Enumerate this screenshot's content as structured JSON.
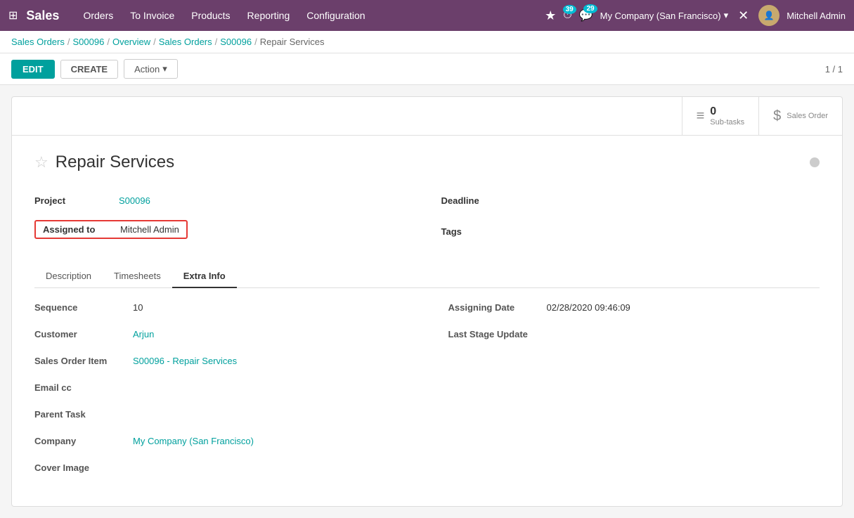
{
  "topnav": {
    "app_title": "Sales",
    "nav_items": [
      "Orders",
      "To Invoice",
      "Products",
      "Reporting",
      "Configuration"
    ],
    "badge_clock": "39",
    "badge_chat": "29",
    "company": "My Company (San Francisco)",
    "user_name": "Mitchell Admin"
  },
  "breadcrumb": {
    "items": [
      "Sales Orders",
      "S00096",
      "Overview",
      "Sales Orders",
      "S00096"
    ],
    "current": "Repair Services"
  },
  "toolbar": {
    "edit_label": "EDIT",
    "create_label": "CREATE",
    "action_label": "Action",
    "record_nav": "1 / 1"
  },
  "smart_buttons": [
    {
      "icon": "≡",
      "count": "0",
      "label": "Sub-tasks"
    },
    {
      "icon": "$",
      "count": "",
      "label": "Sales Order"
    }
  ],
  "form": {
    "title": "Repair Services",
    "project_label": "Project",
    "project_value": "S00096",
    "assigned_to_label": "Assigned to",
    "assigned_to_value": "Mitchell Admin",
    "deadline_label": "Deadline",
    "deadline_value": "",
    "tags_label": "Tags",
    "tags_value": ""
  },
  "tabs": [
    {
      "label": "Description"
    },
    {
      "label": "Timesheets"
    },
    {
      "label": "Extra Info",
      "active": true
    }
  ],
  "extra_info": {
    "left_fields": [
      {
        "label": "Sequence",
        "value": "10",
        "type": "plain"
      },
      {
        "label": "Customer",
        "value": "Arjun",
        "type": "link"
      },
      {
        "label": "Sales Order Item",
        "value": "S00096 - Repair Services",
        "type": "link"
      },
      {
        "label": "Email cc",
        "value": "",
        "type": "empty"
      },
      {
        "label": "Parent Task",
        "value": "",
        "type": "empty"
      },
      {
        "label": "Company",
        "value": "My Company (San Francisco)",
        "type": "link"
      },
      {
        "label": "Cover Image",
        "value": "",
        "type": "empty"
      }
    ],
    "right_fields": [
      {
        "label": "Assigning Date",
        "value": "02/28/2020 09:46:09",
        "type": "plain"
      },
      {
        "label": "Last Stage Update",
        "value": "",
        "type": "empty"
      }
    ]
  }
}
